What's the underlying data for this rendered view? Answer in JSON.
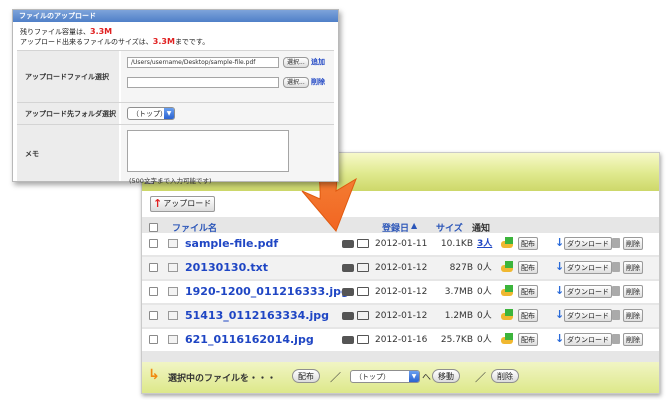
{
  "upload_panel": {
    "title": "ファイルのアップロード",
    "info_line1_prefix": "残りファイル容量は、",
    "remaining": "3.3M",
    "info_line2_prefix": "アップロード出来るファイルのサイズは、",
    "max_size": "3.3M",
    "info_line2_suffix": "までです。",
    "file_select_label": "アップロードファイル選択",
    "file1_value": "/Users/username/Desktop/sample-file.pdf",
    "file2_value": "",
    "browse_label": "選択...",
    "add_label": "追加",
    "delete_label": "削除",
    "folder_label": "アップロード先フォルダ選択",
    "folder_value": "（トップ）",
    "memo_label": "メモ",
    "memo_value": "",
    "memo_note": "(500文字まで入力可能です)"
  },
  "file_list": {
    "upload_button": "アップロード",
    "headers": {
      "file_name": "ファイル名",
      "date": "登録日",
      "size": "サイズ",
      "notify": "通知"
    },
    "rows": [
      {
        "name": "sample-file.pdf",
        "date": "2012-01-11",
        "size": "10.1KB",
        "notify": "3人"
      },
      {
        "name": "20130130.txt",
        "date": "2012-01-12",
        "size": "827B",
        "notify": "0人"
      },
      {
        "name": "1920-1200_011216333.jpg",
        "date": "2012-01-12",
        "size": "3.7MB",
        "notify": "0人"
      },
      {
        "name": "51413_0112163334.jpg",
        "date": "2012-01-12",
        "size": "1.2MB",
        "notify": "0人"
      },
      {
        "name": "621_0116162014.jpg",
        "date": "2012-01-16",
        "size": "25.7KB",
        "notify": "0人"
      }
    ],
    "row_actions": {
      "distribute": "配布",
      "download": "ダウンロード",
      "delete": "削除"
    },
    "bottom": {
      "selected_text": "選択中のファイルを・・・",
      "distribute": "配布",
      "slash": "／",
      "folder_value": "（トップ）",
      "to": "へ",
      "move": "移動",
      "delete": "削除"
    }
  },
  "colors": {
    "accent_blue": "#1f46c4",
    "highlight_red": "#e02020",
    "arrow_orange": "#f26522",
    "bar_yellow_green": "#dfe98d"
  }
}
